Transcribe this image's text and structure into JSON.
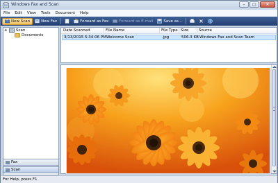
{
  "window": {
    "title": "Windows Fax and Scan"
  },
  "menu": [
    "File",
    "Edit",
    "View",
    "Tools",
    "Document",
    "Help"
  ],
  "toolbar": {
    "new_scan": "New Scan",
    "new_fax": "New Fax",
    "forward_as_fax": "Forward as Fax",
    "forward_as_email": "Forward as E-mail",
    "save_as": "Save as..."
  },
  "tree": {
    "root": "Scan",
    "child": "Documents"
  },
  "nav": {
    "fax": "Fax",
    "scan": "Scan"
  },
  "list": {
    "columns": [
      "Date Scanned",
      "File Name",
      "File Type",
      "Size",
      "Source"
    ],
    "rows": [
      {
        "date": "3/13/2015 5:34:06 PM",
        "name": "Welcome Scan",
        "type": ".jpg",
        "size": "506.3 KB",
        "source": "Windows Fax and Scan Team"
      }
    ]
  },
  "status": "For Help, press F1",
  "colors": {
    "toolbar": "#2e4d82",
    "accent": "#f0c05e",
    "selection": "#cde4fb"
  }
}
